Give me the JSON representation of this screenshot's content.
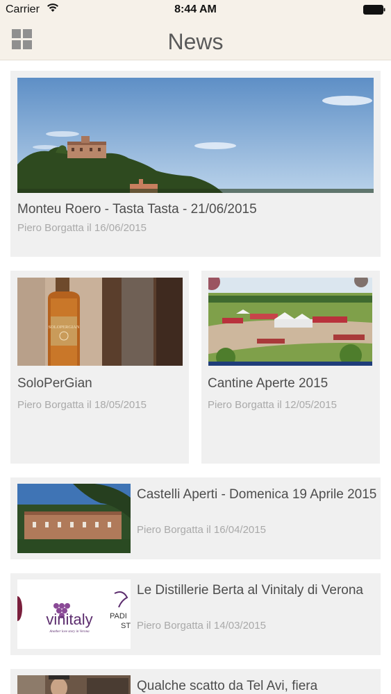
{
  "status_bar": {
    "carrier": "Carrier",
    "time": "8:44 AM"
  },
  "header": {
    "title": "News",
    "menu_icon": "grid-icon"
  },
  "news": {
    "featured": {
      "title": "Monteu Roero - Tasta Tasta - 21/06/2015",
      "meta": "Piero Borgatta il 16/06/2015"
    },
    "grid": [
      {
        "title": "SoloPerGian",
        "meta": "Piero Borgatta il 18/05/2015",
        "bottle_label": "SOLOPERGIAN"
      },
      {
        "title": "Cantine Aperte 2015",
        "meta": "Piero Borgatta il 12/05/2015"
      }
    ],
    "list": [
      {
        "title": "Castelli Aperti - Domenica 19 Aprile 2015",
        "meta": "Piero Borgatta il 16/04/2015"
      },
      {
        "title": "Le Distillerie Berta al Vinitaly di Verona",
        "meta": "Piero Borgatta il 14/03/2015",
        "logo_text": "vinitaly",
        "logo_tagline": "Another love story in Verona",
        "side_text_1": "PADI",
        "side_text_2": "ST"
      },
      {
        "title": "Qualche scatto da Tel Avi, fiera"
      }
    ]
  },
  "colors": {
    "header_bg": "#f6f1e9",
    "card_bg": "#f0f0f0",
    "meta_text": "#a9a9a9",
    "title_text": "#4d4d4d"
  }
}
